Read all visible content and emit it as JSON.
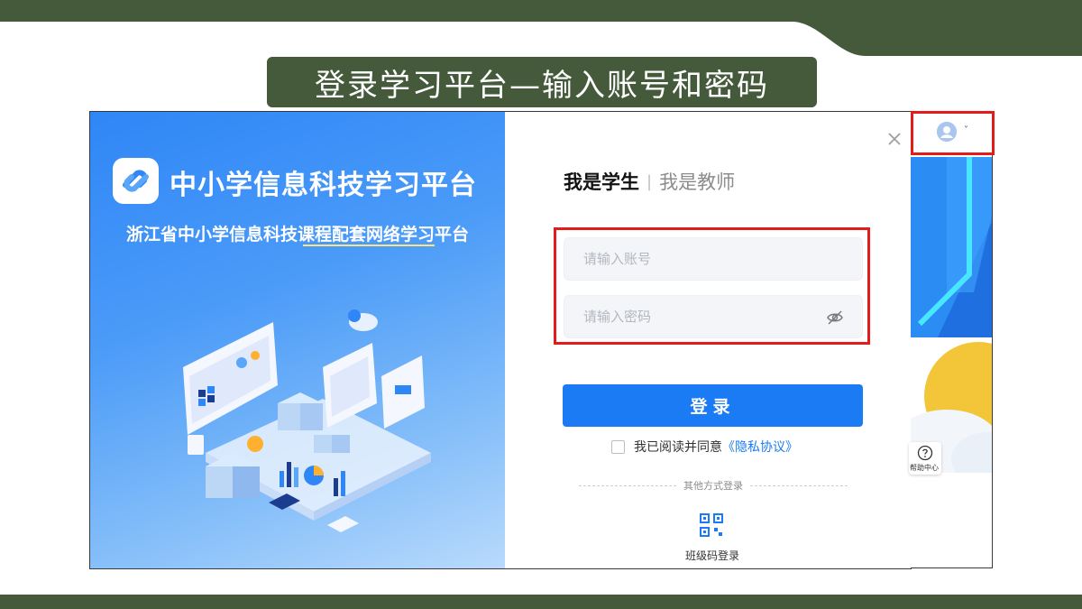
{
  "slide": {
    "title": "登录学习平台—输入账号和密码"
  },
  "brand": {
    "name": "中小学信息科技学习平台",
    "subtitle": "浙江省中小学信息科技课程配套网络学习平台",
    "logo_icon": "link-logo-icon",
    "illustration_icon": "isometric-dashboard-illustration"
  },
  "login": {
    "tabs": [
      {
        "label": "我是学生",
        "active": true
      },
      {
        "label": "我是教师",
        "active": false
      }
    ],
    "tab_separator": "|",
    "account_placeholder": "请输入账号",
    "password_placeholder": "请输入密码",
    "password_toggle_icon": "eye-off-icon",
    "submit_label": "登录",
    "agree_text": "我已阅读并同意",
    "privacy_link": "《隐私协议》",
    "agree_checked": false,
    "other_methods_label": "其他方式登录",
    "class_code_label": "班级码登录",
    "class_code_icon": "qr-code-icon",
    "close_icon": "close-icon"
  },
  "side": {
    "avatar_icon": "user-avatar-icon",
    "avatar_chevron": "˅",
    "help_label": "帮助中心",
    "help_icon": "question-circle-icon"
  },
  "colors": {
    "band": "#445a3b",
    "primary": "#1a7bf5",
    "highlight": "#e41b1b"
  }
}
